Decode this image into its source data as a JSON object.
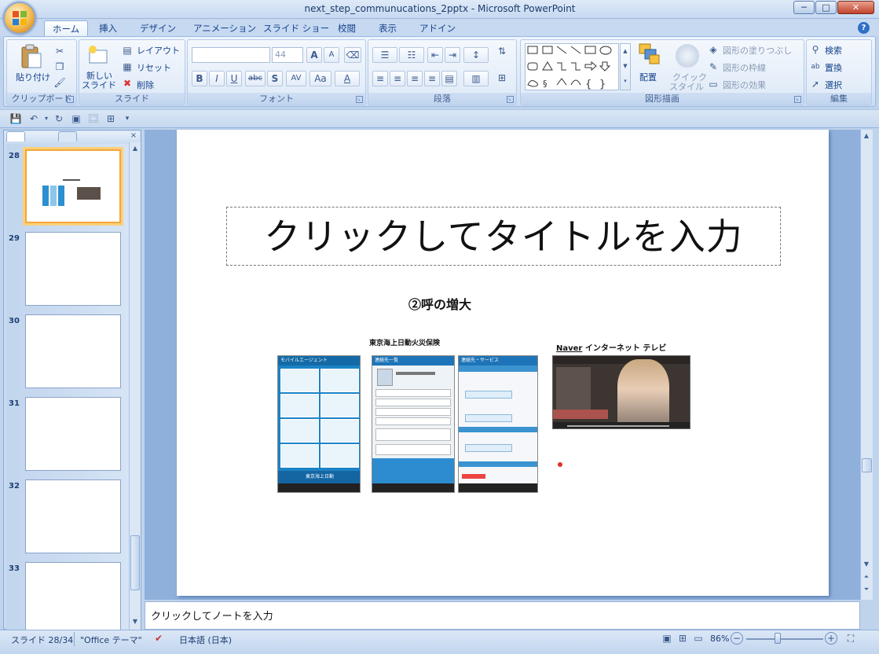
{
  "window": {
    "title": "next_step_communucations_2pptx - Microsoft PowerPoint",
    "minimize": "─",
    "maximize": "□",
    "close": "✕"
  },
  "ribbon_tabs": [
    "ホーム",
    "挿入",
    "デザイン",
    "アニメーション",
    "スライド ショー",
    "校閲",
    "表示",
    "アドイン"
  ],
  "ribbon": {
    "clipboard": {
      "paste": "貼り付け",
      "label": "クリップボード"
    },
    "slides": {
      "new_slide_line1": "新しい",
      "new_slide_line2": "スライド",
      "layout": "レイアウト",
      "reset": "リセット",
      "delete": "削除",
      "label": "スライド"
    },
    "font": {
      "font_name": "",
      "font_size": "44",
      "bold": "B",
      "italic": "I",
      "underline": "U",
      "strike": "abc",
      "shadow": "S",
      "spacing": "AV",
      "case": "Aa",
      "color": "A",
      "grow": "A",
      "shrink": "A",
      "label": "フォント"
    },
    "paragraph": {
      "label": "段落"
    },
    "drawing": {
      "arrange": "配置",
      "quick_style_line1": "クイック",
      "quick_style_line2": "スタイル",
      "shape_fill": "図形の塗りつぶし",
      "shape_outline": "図形の枠線",
      "shape_effects": "図形の効果",
      "label": "図形描画"
    },
    "editing": {
      "find": "検索",
      "replace": "置換",
      "select": "選択",
      "label": "編集"
    }
  },
  "slide_thumbnails": [
    {
      "number": "28",
      "selected": true
    },
    {
      "number": "29",
      "selected": false
    },
    {
      "number": "30",
      "selected": false
    },
    {
      "number": "31",
      "selected": false
    },
    {
      "number": "32",
      "selected": false
    },
    {
      "number": "33",
      "selected": false
    }
  ],
  "slide": {
    "title_placeholder": "クリックしてタイトルを入力",
    "subheading": "②呼の増大",
    "caption_left": "東京海上日動火災保険",
    "caption_right_brand": "Naver",
    "caption_right_rest": " インターネット テレビ",
    "phone1_header": "モバイルエージェント",
    "phone2_header": "連絡先一覧",
    "phone3_header": "連絡先・サービス",
    "phone1_footer": "東京海上日動"
  },
  "notes_placeholder": "クリックしてノートを入力",
  "status": {
    "slide_indicator": "スライド 28/34",
    "theme": "\"Office テーマ\"",
    "language": "日本語 (日本)",
    "zoom": "86%"
  },
  "colors": {
    "accent": "#15428b",
    "selection": "#f3a63b",
    "ribbon_bg": "#dce8f6"
  }
}
